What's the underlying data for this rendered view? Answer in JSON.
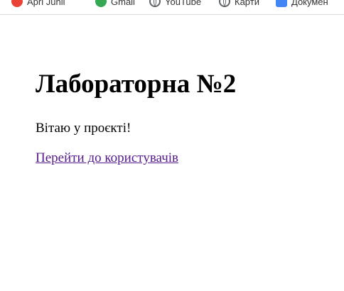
{
  "bookmarks": [
    {
      "label": "Apri Junii",
      "icon": "red-circle-icon",
      "color": "#ea4335"
    },
    {
      "label": "Gmail",
      "icon": "green-circle-icon",
      "color": "#34a853"
    },
    {
      "label": "YouTube",
      "icon": "globe-icon",
      "color": "#5f6368"
    },
    {
      "label": "Карти",
      "icon": "globe-icon",
      "color": "#5f6368"
    },
    {
      "label": "Докумен",
      "icon": "docs-icon",
      "color": "#4285f4"
    }
  ],
  "page": {
    "title": "Лабораторна №2",
    "welcome": "Вітаю у проєкті!",
    "link_label": "Перейти до користувачів",
    "link_color": "#551a8b"
  }
}
